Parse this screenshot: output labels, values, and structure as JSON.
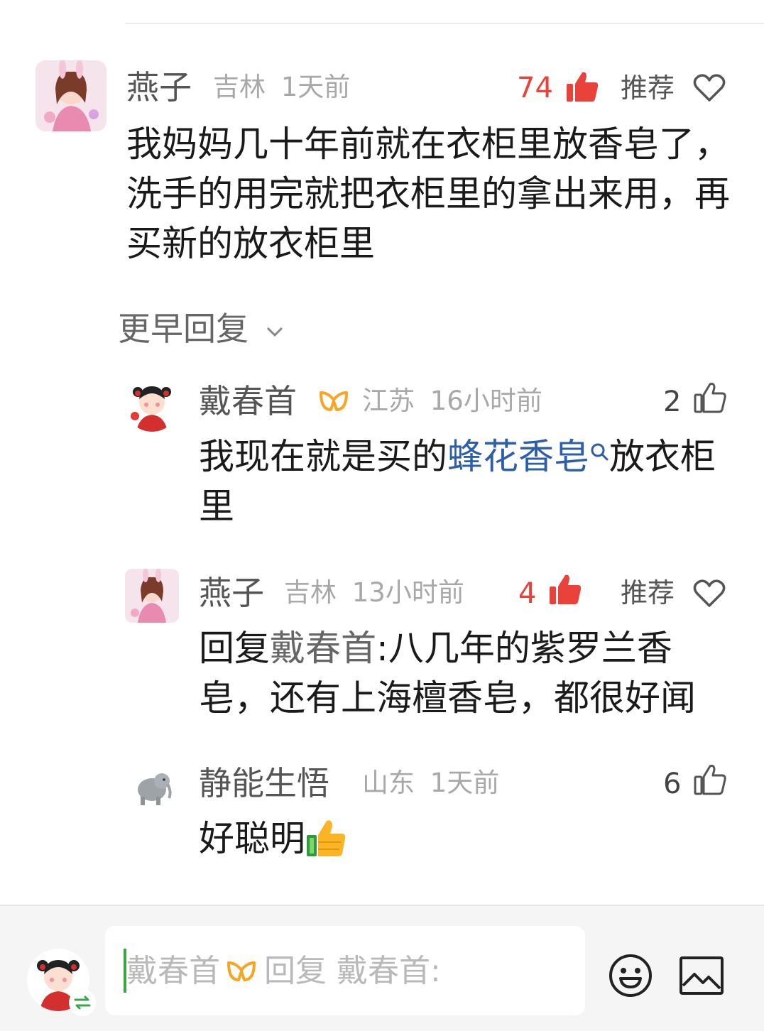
{
  "comment": {
    "author": "燕子",
    "location": "吉林",
    "time": "1天前",
    "likes": "74",
    "recommend": "推荐",
    "text": "我妈妈几十年前就在衣柜里放香皂了，洗手的用完就把衣柜里的拿出来用，再买新的放衣柜里"
  },
  "earlier_replies_label": "更早回复",
  "replies": [
    {
      "author": "戴春首",
      "location": "江苏",
      "time": "16小时前",
      "likes": "2",
      "text_before": "我现在就是买的",
      "link_text": "蜂花香皂",
      "text_after": "放衣柜里"
    },
    {
      "author": "燕子",
      "location": "吉林",
      "time": "13小时前",
      "likes": "4",
      "recommend": "推荐",
      "reply_prefix": "回复",
      "reply_to": "戴春首",
      "text": ":八几年的紫罗兰香皂，还有上海檀香皂，都很好闻"
    },
    {
      "author": "静能生悟",
      "location": "山东",
      "time": "1天前",
      "likes": "6",
      "text": "好聪明"
    }
  ],
  "input": {
    "author": "戴春首",
    "placeholder_prefix": "回复 戴春首:"
  },
  "colors": {
    "accent_red": "#e8423a",
    "link_blue": "#2d5fa8",
    "badge_orange": "#f5a623",
    "caret_green": "#3aa64a"
  },
  "icons": [
    "thumbs-up-filled-icon",
    "thumbs-up-outline-icon",
    "heart-outline-icon",
    "vip-badge-icon",
    "search-icon",
    "thumbs-up-emoji-icon",
    "emoji-icon",
    "image-icon",
    "switch-account-icon",
    "chevron-down-icon"
  ]
}
